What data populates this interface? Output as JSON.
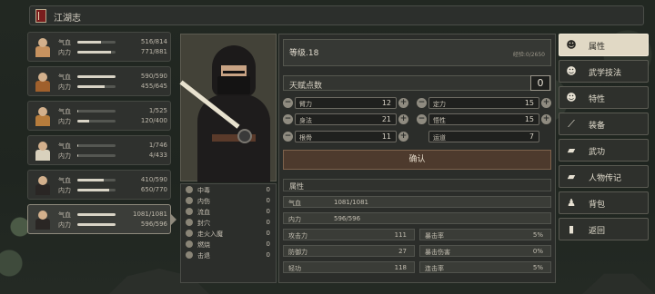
{
  "header": {
    "title": "江湖志"
  },
  "party": [
    {
      "hp_label": "气血",
      "hp": "516/814",
      "hp_frac": 0.63,
      "mp_label": "内力",
      "mp": "771/881",
      "mp_frac": 0.88,
      "avatar_color": "#c7925f"
    },
    {
      "hp_label": "气血",
      "hp": "590/590",
      "hp_frac": 1.0,
      "mp_label": "内力",
      "mp": "455/645",
      "mp_frac": 0.71,
      "avatar_color": "#a0602c"
    },
    {
      "hp_label": "气血",
      "hp": "1/525",
      "hp_frac": 0.01,
      "mp_label": "内力",
      "mp": "120/400",
      "mp_frac": 0.3,
      "avatar_color": "#b77c3c"
    },
    {
      "hp_label": "气血",
      "hp": "1/746",
      "hp_frac": 0.01,
      "mp_label": "内力",
      "mp": "4/433",
      "mp_frac": 0.01,
      "avatar_color": "#d9d1bd"
    },
    {
      "hp_label": "气血",
      "hp": "410/590",
      "hp_frac": 0.69,
      "mp_label": "内力",
      "mp": "650/770",
      "mp_frac": 0.84,
      "avatar_color": "#2a2624"
    },
    {
      "hp_label": "气血",
      "hp": "1081/1081",
      "hp_frac": 1.0,
      "mp_label": "内力",
      "mp": "596/596",
      "mp_frac": 1.0,
      "avatar_color": "#2a2624",
      "selected": true
    }
  ],
  "status": [
    {
      "label": "中毒",
      "value": "0"
    },
    {
      "label": "内伤",
      "value": "0"
    },
    {
      "label": "流血",
      "value": "0"
    },
    {
      "label": "封穴",
      "value": "0"
    },
    {
      "label": "走火入魔",
      "value": "0"
    },
    {
      "label": "燃烧",
      "value": "0"
    },
    {
      "label": "击退",
      "value": "0"
    }
  ],
  "level": {
    "text": "等级.18",
    "exp": "经验:0/2650"
  },
  "points": {
    "label": "天赋点数",
    "value": "0"
  },
  "attributes": {
    "strength": {
      "label": "臂力",
      "value": "12"
    },
    "focus": {
      "label": "定力",
      "value": "15"
    },
    "agility": {
      "label": "身法",
      "value": "21"
    },
    "wisdom": {
      "label": "悟性",
      "value": "15"
    },
    "constitution": {
      "label": "根骨",
      "value": "11"
    },
    "fortune": {
      "label": "运道",
      "value": "7"
    }
  },
  "confirm_label": "确认",
  "props": {
    "title": "属性",
    "hp_label": "气血",
    "hp_value": "1081/1081",
    "mp_label": "内力",
    "mp_value": "596/596",
    "atk_label": "攻击力",
    "atk_value": "111",
    "crit_rate_label": "暴击率",
    "crit_rate_value": "5%",
    "def_label": "防御力",
    "def_value": "27",
    "crit_dmg_label": "暴击伤害",
    "crit_dmg_value": "0%",
    "qinggong_label": "轻功",
    "qinggong_value": "118",
    "combo_label": "连击率",
    "combo_value": "5%"
  },
  "menu": [
    {
      "label": "属性",
      "icon": "person-icon",
      "glyph": "☻",
      "active": true
    },
    {
      "label": "武学技法",
      "icon": "martial-person-icon",
      "glyph": "☻"
    },
    {
      "label": "特性",
      "icon": "trait-person-icon",
      "glyph": "☻"
    },
    {
      "label": "装备",
      "icon": "sword-icon",
      "glyph": "⟋"
    },
    {
      "label": "武功",
      "icon": "book-icon",
      "glyph": "▰"
    },
    {
      "label": "人物传记",
      "icon": "biography-icon",
      "glyph": "▰"
    },
    {
      "label": "背包",
      "icon": "bag-icon",
      "glyph": "♟"
    },
    {
      "label": "返回",
      "icon": "exit-door-icon",
      "glyph": "▮"
    }
  ]
}
